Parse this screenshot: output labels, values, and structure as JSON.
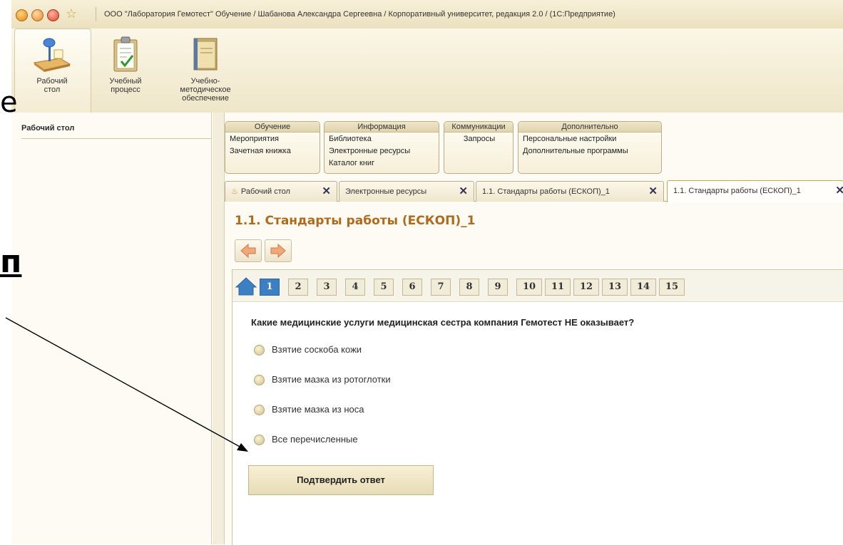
{
  "window": {
    "title": "ООО \"Лаборатория Гемотест\" Обучение / Шабанова Александра Сергеевна / Корпоративный университет, редакция 2.0 /  (1С:Предприятие)"
  },
  "ribbon": {
    "items": [
      {
        "line1": "Рабочий",
        "line2": "стол"
      },
      {
        "line1": "Учебный",
        "line2": "процесс"
      },
      {
        "line1": "Учебно-методическое",
        "line2": "обеспечение"
      }
    ]
  },
  "sidebar": {
    "title": "Рабочий стол"
  },
  "menu": {
    "groups": [
      {
        "title": "Обучение",
        "items": [
          "Мероприятия",
          "Зачетная книжка"
        ]
      },
      {
        "title": "Информация",
        "items": [
          "Библиотека",
          "Электронные ресурсы",
          "Каталог книг"
        ]
      },
      {
        "title": "Коммуникации",
        "items": [
          "Запросы"
        ]
      },
      {
        "title": "Дополнительно",
        "items": [
          "Персональные настройки",
          "Дополнительные программы"
        ]
      }
    ]
  },
  "tabs": [
    {
      "label": "Рабочий стол"
    },
    {
      "label": "Электронные ресурсы"
    },
    {
      "label": "1.1. Стандарты работы (ЕСКОП)_1"
    },
    {
      "label": "1.1. Стандарты работы (ЕСКОП)_1"
    }
  ],
  "page": {
    "title": "1.1. Стандарты работы (ЕСКОП)_1"
  },
  "question_nav": {
    "numbers": [
      "1",
      "2",
      "3",
      "4",
      "5",
      "6",
      "7",
      "8",
      "9",
      "10",
      "11",
      "12",
      "13",
      "14",
      "15"
    ],
    "active": "1"
  },
  "question": {
    "text": "Какие медицинские услуги медицинская сестра компания Гемотест НЕ оказывает?",
    "options": [
      "Взятие соскоба кожи",
      "Взятие мазка из ротоглотки",
      "Взятие мазка из носа",
      "Все перечисленные"
    ]
  },
  "submit": {
    "label": "Подтвердить ответ"
  },
  "background": {
    "fragment_a": "e",
    "fragment_b": "п"
  },
  "colors": {
    "accent_title": "#b06a1c",
    "active_page": "#3c7fc2",
    "ribbon_bg": "#efe6c8"
  }
}
